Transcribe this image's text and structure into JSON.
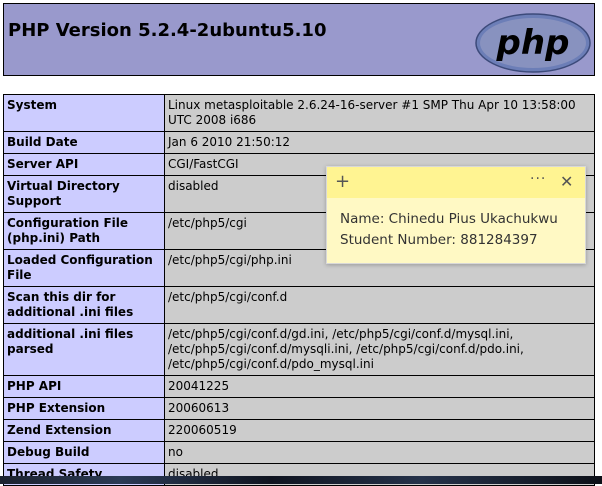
{
  "page": {
    "title": "PHP Version 5.2.4-2ubuntu5.10",
    "logo_text": "php"
  },
  "rows": [
    {
      "label": "System",
      "value": "Linux metasploitable 2.6.24-16-server #1 SMP Thu Apr 10 13:58:00 UTC 2008 i686"
    },
    {
      "label": "Build Date",
      "value": "Jan 6 2010 21:50:12"
    },
    {
      "label": "Server API",
      "value": "CGI/FastCGI"
    },
    {
      "label": "Virtual Directory Support",
      "value": "disabled"
    },
    {
      "label": "Configuration File (php.ini) Path",
      "value": "/etc/php5/cgi"
    },
    {
      "label": "Loaded Configuration File",
      "value": "/etc/php5/cgi/php.ini"
    },
    {
      "label": "Scan this dir for additional .ini files",
      "value": "/etc/php5/cgi/conf.d"
    },
    {
      "label": "additional .ini files parsed",
      "value": "/etc/php5/cgi/conf.d/gd.ini, /etc/php5/cgi/conf.d/mysql.ini, /etc/php5/cgi/conf.d/mysqli.ini, /etc/php5/cgi/conf.d/pdo.ini, /etc/php5/cgi/conf.d/pdo_mysql.ini"
    },
    {
      "label": "PHP API",
      "value": "20041225"
    },
    {
      "label": "PHP Extension",
      "value": "20060613"
    },
    {
      "label": "Zend Extension",
      "value": "220060519"
    },
    {
      "label": "Debug Build",
      "value": "no"
    },
    {
      "label": "Thread Safety",
      "value": "disabled"
    }
  ],
  "sticky_note": {
    "add_glyph": "+",
    "menu_glyph": "···",
    "close_glyph": "✕",
    "line1": "Name: Chinedu Pius Ukachukwu",
    "line2": "Student Number: 881284397"
  }
}
